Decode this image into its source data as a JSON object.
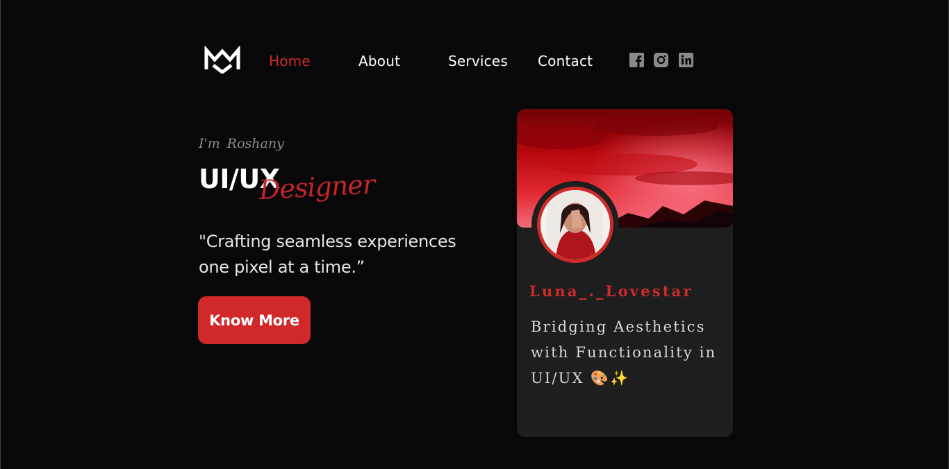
{
  "nav": {
    "items": [
      {
        "label": "Home",
        "active": true
      },
      {
        "label": "About",
        "active": false
      },
      {
        "label": "Services",
        "active": false
      },
      {
        "label": "Contact",
        "active": false
      }
    ],
    "social": [
      "facebook-icon",
      "instagram-icon",
      "linkedin-icon"
    ]
  },
  "hero": {
    "intro": "I'm  Roshany",
    "title": "UI/UX",
    "title_script": "Designer",
    "tagline": "\"Crafting seamless experiences one pixel at a time.”",
    "cta_label": "Know More"
  },
  "card": {
    "handle": "Luna_._Lovestar",
    "bio": "Bridging Aesthetics with Functionality in UI/UX 🎨✨"
  },
  "colors": {
    "background": "#08080a",
    "accent": "#d1282a",
    "card": "#1e1e1f"
  }
}
